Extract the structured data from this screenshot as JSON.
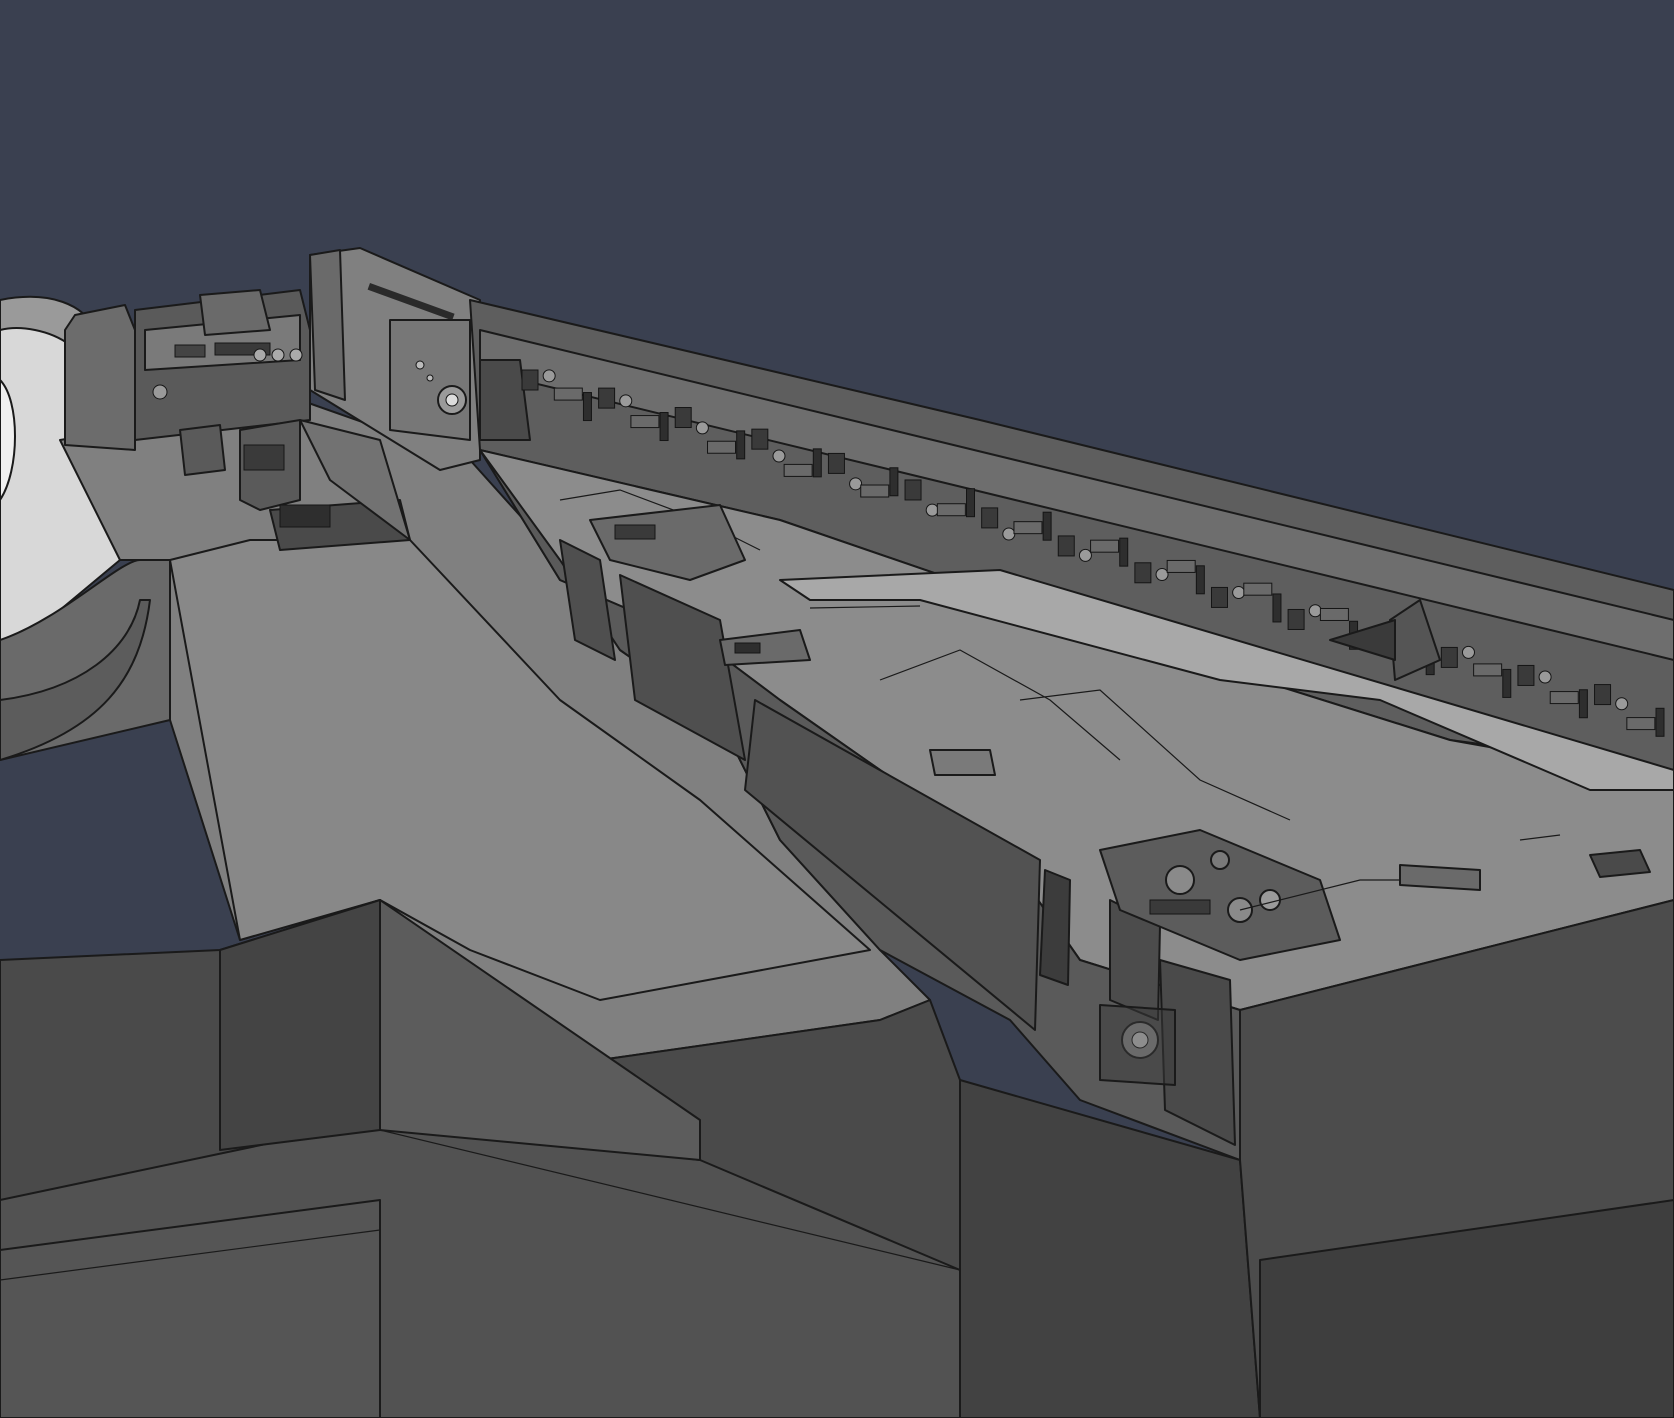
{
  "viewport": {
    "background_color": "#3a4050",
    "render_style": "shaded-with-edges"
  },
  "palette": {
    "face_light": "#8a8a8a",
    "face_mid": "#7a7a7a",
    "face_dark": "#4e4e4e",
    "face_darker": "#424242",
    "face_highlight": "#a6a6a6",
    "edge_color": "#1a1a1a"
  },
  "detail_strip": {
    "fixture_count": 60
  }
}
